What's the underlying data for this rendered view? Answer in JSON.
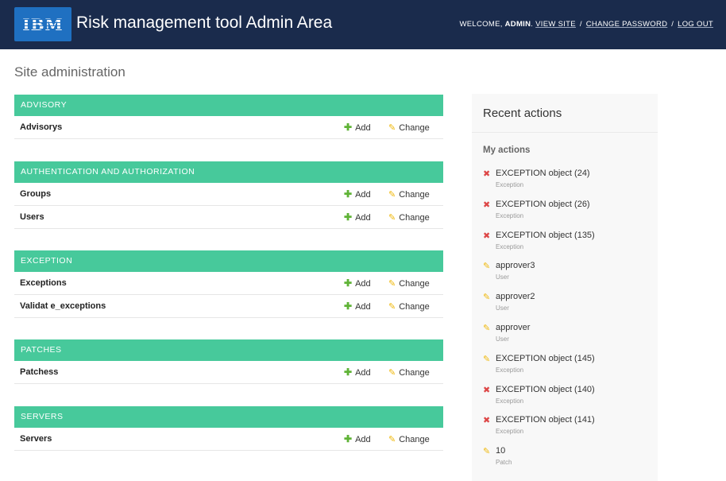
{
  "header": {
    "logo_text": "IBM",
    "site_title": "Risk management tool Admin Area",
    "welcome": "WELCOME,",
    "username": "ADMIN",
    "view_site": "VIEW SITE",
    "change_password": "CHANGE PASSWORD",
    "log_out": "LOG OUT"
  },
  "page_title": "Site administration",
  "labels": {
    "add": "Add",
    "change": "Change"
  },
  "modules": [
    {
      "caption": "ADVISORY",
      "models": [
        "Advisorys"
      ]
    },
    {
      "caption": "AUTHENTICATION AND AUTHORIZATION",
      "models": [
        "Groups",
        "Users"
      ]
    },
    {
      "caption": "EXCEPTION",
      "models": [
        "Exceptions",
        "Validat e_exceptions"
      ]
    },
    {
      "caption": "PATCHES",
      "models": [
        "Patchess"
      ]
    },
    {
      "caption": "SERVERS",
      "models": [
        "Servers"
      ]
    }
  ],
  "recent_actions": {
    "title": "Recent actions",
    "my_actions": "My actions",
    "items": [
      {
        "icon": "delete-icon",
        "title": "EXCEPTION object (24)",
        "type": "Exception"
      },
      {
        "icon": "delete-icon",
        "title": "EXCEPTION object (26)",
        "type": "Exception"
      },
      {
        "icon": "delete-icon",
        "title": "EXCEPTION object (135)",
        "type": "Exception"
      },
      {
        "icon": "pencil-icon",
        "title": "approver3",
        "type": "User"
      },
      {
        "icon": "pencil-icon",
        "title": "approver2",
        "type": "User"
      },
      {
        "icon": "pencil-icon",
        "title": "approver",
        "type": "User"
      },
      {
        "icon": "pencil-icon",
        "title": "EXCEPTION object (145)",
        "type": "Exception"
      },
      {
        "icon": "delete-icon",
        "title": "EXCEPTION object (140)",
        "type": "Exception"
      },
      {
        "icon": "delete-icon",
        "title": "EXCEPTION object (141)",
        "type": "Exception"
      },
      {
        "icon": "pencil-icon",
        "title": "10",
        "type": "Patch"
      }
    ]
  },
  "colors": {
    "header_bg": "#1a2b4c",
    "module_caption_bg": "#47c99b",
    "add_icon": "#5fb336",
    "change_icon": "#efb80b",
    "delete_icon": "#dd4646"
  }
}
